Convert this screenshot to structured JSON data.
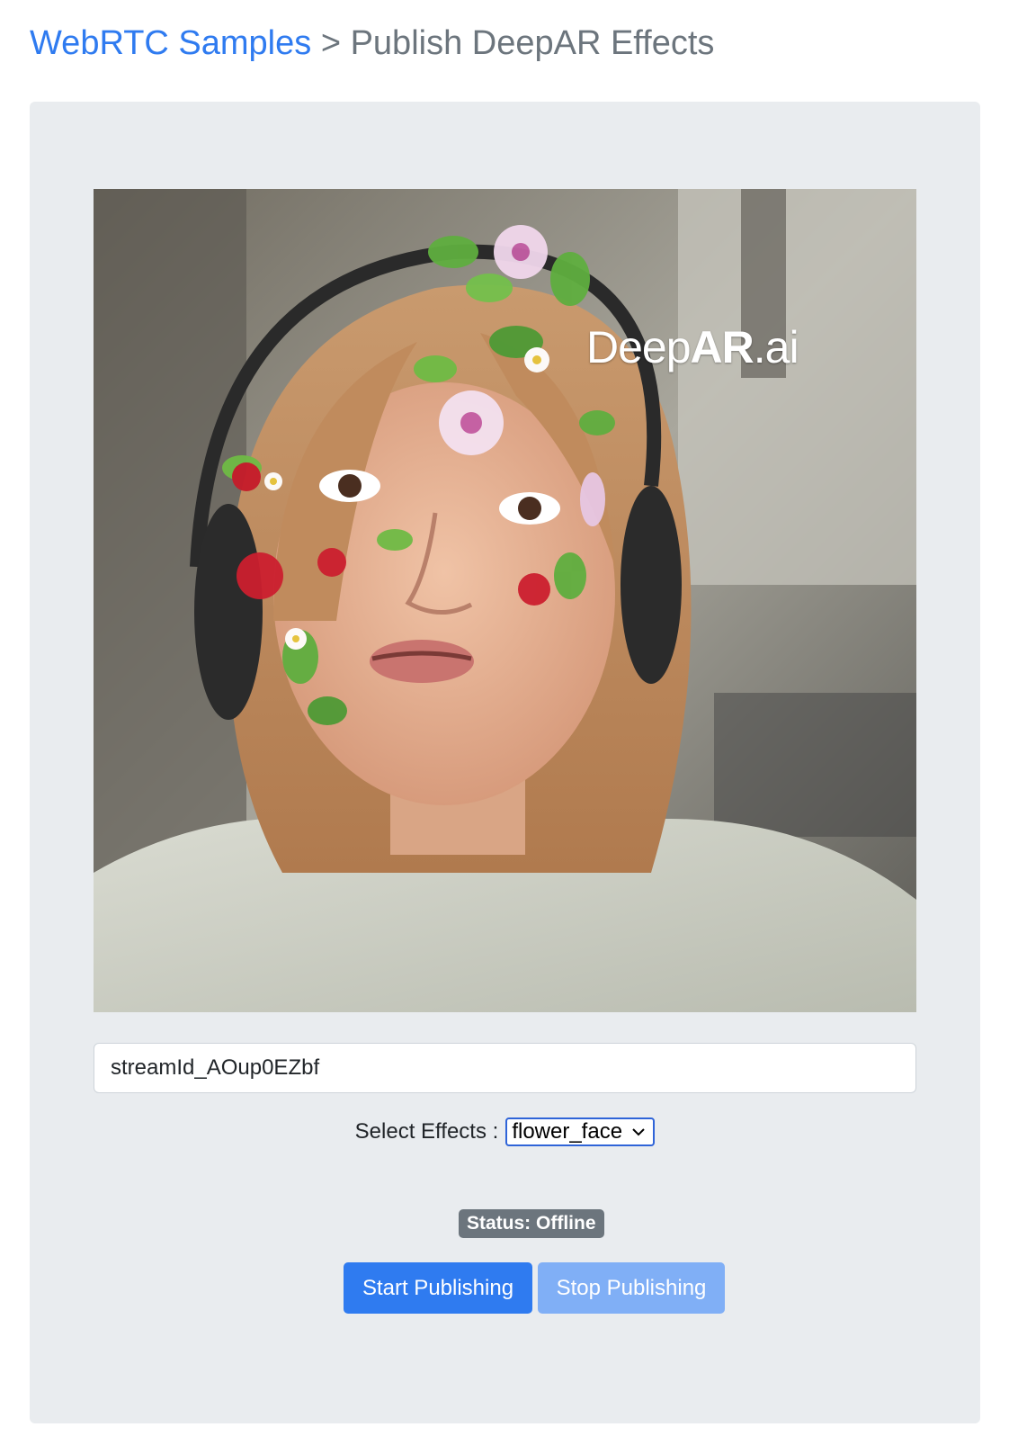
{
  "header": {
    "link_label": "WebRTC Samples",
    "separator": " > ",
    "page_title": "Publish DeepAR Effects"
  },
  "video": {
    "watermark_regular": "Deep",
    "watermark_bold": "AR",
    "watermark_suffix": ".ai"
  },
  "stream": {
    "stream_id_value": "streamId_AOup0EZbf"
  },
  "effects": {
    "label": "Select Effects :",
    "selected": "flower_face"
  },
  "status": {
    "text": "Status: Offline"
  },
  "buttons": {
    "start_label": "Start Publishing",
    "stop_label": "Stop Publishing"
  },
  "colors": {
    "link_blue": "#2f7bf0",
    "panel_bg": "#e9ecef",
    "badge_gray": "#6c757d",
    "disabled_blue": "#80aff6"
  },
  "icons": {
    "select_chevron": "chevron-down-icon"
  }
}
